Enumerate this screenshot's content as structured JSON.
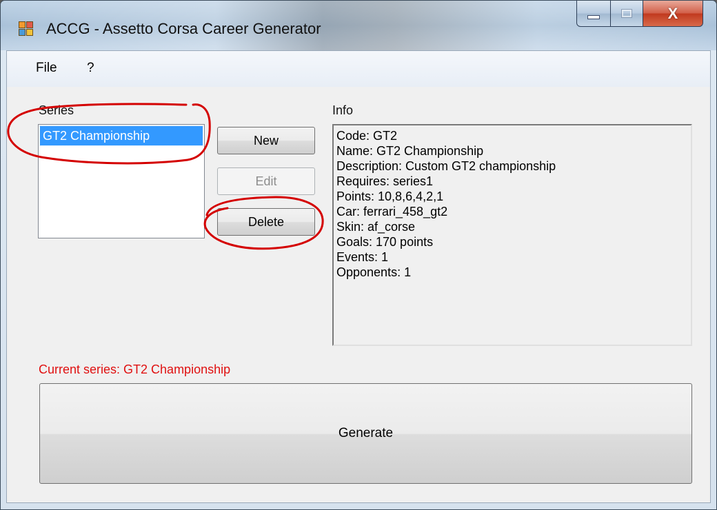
{
  "window": {
    "title": "ACCG - Assetto Corsa Career Generator",
    "close_glyph": "X"
  },
  "menu": {
    "file": "File",
    "help": "?"
  },
  "series": {
    "label": "Series",
    "items": [
      "GT2 Championship"
    ],
    "selected_index": 0
  },
  "buttons": {
    "new": "New",
    "edit": "Edit",
    "delete": "Delete",
    "generate": "Generate"
  },
  "info": {
    "label": "Info",
    "lines": [
      "Code: GT2",
      "Name: GT2 Championship",
      "Description: Custom GT2 championship",
      "Requires: series1",
      "Points: 10,8,6,4,2,1",
      "Car: ferrari_458_gt2",
      "Skin: af_corse",
      "Goals: 170 points",
      "Events: 1",
      "Opponents: 1"
    ]
  },
  "status": {
    "current_series": "Current series: GT2 Championship"
  },
  "colors": {
    "selection": "#3399ff",
    "status_text": "#e01010",
    "annotation": "#d40000"
  },
  "icons": {
    "app": "app-grid-icon",
    "minimize": "minimize-icon",
    "maximize": "maximize-icon",
    "close": "close-icon"
  }
}
